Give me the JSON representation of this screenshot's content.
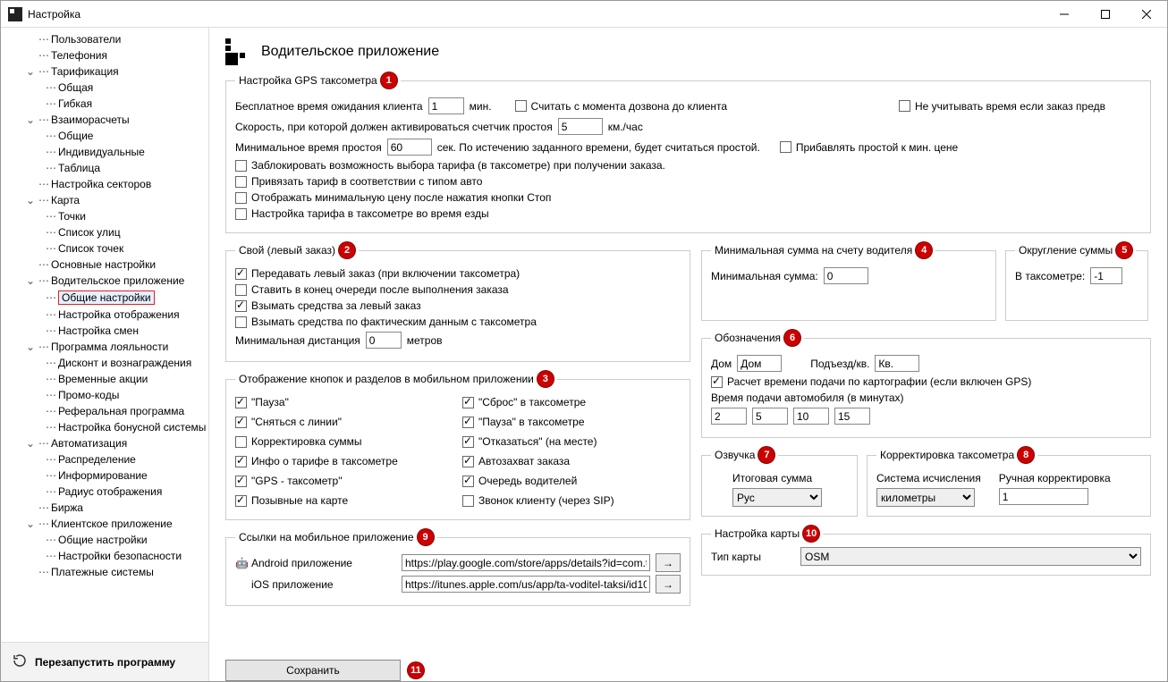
{
  "window": {
    "title": "Настройка"
  },
  "winbtns": {
    "min": "—",
    "max": "☐",
    "close": "✕"
  },
  "tree": [
    {
      "l": 1,
      "caret": "",
      "label": "Пользователи"
    },
    {
      "l": 1,
      "caret": "",
      "label": "Телефония"
    },
    {
      "l": 1,
      "caret": "v",
      "label": "Тарификация"
    },
    {
      "l": 2,
      "caret": "",
      "label": "Общая"
    },
    {
      "l": 2,
      "caret": "",
      "label": "Гибкая"
    },
    {
      "l": 1,
      "caret": "v",
      "label": "Взаиморасчеты"
    },
    {
      "l": 2,
      "caret": "",
      "label": "Общие"
    },
    {
      "l": 2,
      "caret": "",
      "label": "Индивидуальные"
    },
    {
      "l": 2,
      "caret": "",
      "label": "Таблица"
    },
    {
      "l": 1,
      "caret": "",
      "label": "Настройка секторов"
    },
    {
      "l": 1,
      "caret": "v",
      "label": "Карта"
    },
    {
      "l": 2,
      "caret": "",
      "label": "Точки"
    },
    {
      "l": 2,
      "caret": "",
      "label": "Список улиц"
    },
    {
      "l": 2,
      "caret": "",
      "label": "Список точек"
    },
    {
      "l": 1,
      "caret": "",
      "label": "Основные настройки"
    },
    {
      "l": 1,
      "caret": "v",
      "label": "Водительское приложение"
    },
    {
      "l": 2,
      "caret": "",
      "label": "Общие настройки",
      "selected": true
    },
    {
      "l": 2,
      "caret": "",
      "label": "Настройка отображения"
    },
    {
      "l": 2,
      "caret": "",
      "label": "Настройка смен"
    },
    {
      "l": 1,
      "caret": "v",
      "label": "Программа лояльности"
    },
    {
      "l": 2,
      "caret": "",
      "label": "Дисконт и вознаграждения"
    },
    {
      "l": 2,
      "caret": "",
      "label": "Временные акции"
    },
    {
      "l": 2,
      "caret": "",
      "label": "Промо-коды"
    },
    {
      "l": 2,
      "caret": "",
      "label": "Реферальная программа"
    },
    {
      "l": 2,
      "caret": "",
      "label": "Настройка бонусной системы"
    },
    {
      "l": 1,
      "caret": "v",
      "label": "Автоматизация"
    },
    {
      "l": 2,
      "caret": "",
      "label": "Распределение"
    },
    {
      "l": 2,
      "caret": "",
      "label": "Информирование"
    },
    {
      "l": 2,
      "caret": "",
      "label": "Радиус отображения"
    },
    {
      "l": 1,
      "caret": "",
      "label": "Биржа"
    },
    {
      "l": 1,
      "caret": "v",
      "label": "Клиентское приложение"
    },
    {
      "l": 2,
      "caret": "",
      "label": "Общие настройки"
    },
    {
      "l": 2,
      "caret": "",
      "label": "Настройки безопасности"
    },
    {
      "l": 1,
      "caret": "",
      "label": "Платежные системы"
    }
  ],
  "restart": "Перезапустить программу",
  "page": {
    "title": "Водительское приложение"
  },
  "gps": {
    "legend": "Настройка GPS таксометра",
    "free_wait": "Бесплатное время ожидания клиента",
    "free_wait_val": "1",
    "min": "мин.",
    "count_from_call": "Считать с момента дозвона до клиента",
    "ignore_time": "Не учитывать время если заказ предв",
    "speed": "Скорость, при которой должен активироваться счетчик простоя",
    "speed_val": "5",
    "kmh": "км./час",
    "idle": "Минимальное время простоя",
    "idle_val": "60",
    "sec_hint": "сек.  По истечению заданного времени, будет считаться простой.",
    "add_idle": "Прибавлять простой к мин. цене",
    "lock_tariff": "Заблокировать возможность выбора тарифа (в таксометре) при получении заказа.",
    "bind_tariff": "Привязать тариф в соответствии с типом авто",
    "show_min": "Отображать минимальную цену после нажатия кнопки Стоп",
    "tariff_driving": "Настройка тарифа в таксометре во время езды"
  },
  "own": {
    "legend": "Свой (левый заказ)",
    "transfer": "Передавать левый заказ (при включении таксометра)",
    "queue_end": "Ставить в конец очереди после выполнения заказа",
    "charge": "Взымать средства за левый заказ",
    "charge_fact": "Взымать средства по фактическим данным с таксометра",
    "min_dist": "Минимальная дистанция",
    "min_dist_val": "0",
    "meters": "метров"
  },
  "display": {
    "legend": "Отображение кнопок и разделов в мобильном приложении",
    "pause": "\"Пауза\"",
    "offline": "\"Сняться с линии\"",
    "corr_sum": "Корректировка суммы",
    "tariff_info": "Инфо о тарифе в таксометре",
    "gps_tax": "\"GPS - таксометр\"",
    "callsigns": "Позывные на карте",
    "reset": "\"Сброс\" в таксометре",
    "pause_tax": "\"Пауза\" в таксометре",
    "refuse": "\"Отказаться\" (на месте)",
    "autocapture": "Автозахват заказа",
    "queue": "Очередь водителей",
    "sip_call": "Звонок клиенту (через SIP)"
  },
  "links": {
    "legend": "Ссылки на мобильное приложение",
    "android_lbl": "Android приложение",
    "android": "https://play.google.com/store/apps/details?id=com.ta",
    "ios_lbl": "iOS приложение",
    "ios": "https://itunes.apple.com/us/app/ta-voditel-taksi/id10"
  },
  "min_sum": {
    "legend": "Минимальная сумма на счету водителя",
    "label": "Минимальная сумма:",
    "val": "0"
  },
  "round": {
    "legend": "Округление суммы",
    "label": "В таксометре:",
    "val": "-1"
  },
  "marks": {
    "legend": "Обозначения",
    "house_lbl": "Дом",
    "house_val": "Дом",
    "entrance_lbl": "Подъезд/кв.",
    "entrance_val": "Кв.",
    "gps_time": "Расчет времени подачи по картографии (если включен GPS)",
    "arrival": "Время подачи автомобиля (в минутах)",
    "t1": "2",
    "t2": "5",
    "t3": "10",
    "t4": "15"
  },
  "voice": {
    "legend": "Озвучка",
    "total": "Итоговая сумма",
    "lang": "Рус"
  },
  "corr": {
    "legend": "Корректировка таксометра",
    "sys_lbl": "Система исчисления",
    "sys_val": "километры",
    "manual_lbl": "Ручная корректировка",
    "manual_val": "1"
  },
  "map": {
    "legend": "Настройка карты",
    "type_lbl": "Тип карты",
    "type_val": "OSM"
  },
  "save": "Сохранить",
  "badges": {
    "b1": "1",
    "b2": "2",
    "b3": "3",
    "b4": "4",
    "b5": "5",
    "b6": "6",
    "b7": "7",
    "b8": "8",
    "b9": "9",
    "b10": "10",
    "b11": "11"
  }
}
